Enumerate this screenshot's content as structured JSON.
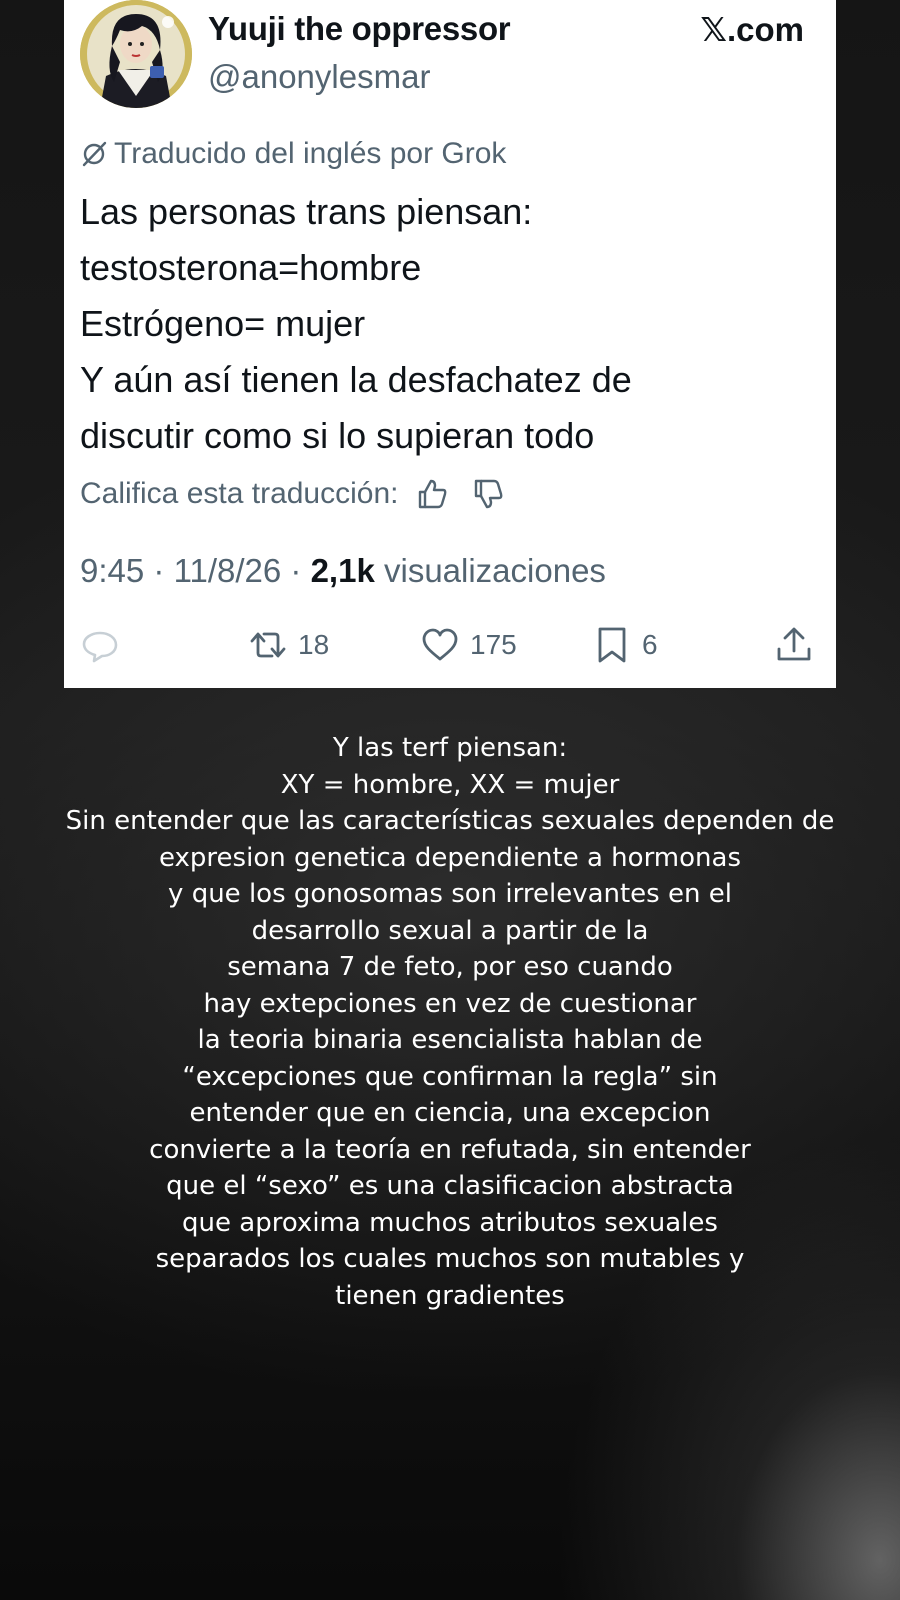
{
  "tweet": {
    "author": {
      "display_name": "Yuuji the oppressor",
      "handle": "@anonylesmar",
      "avatar_icon": "comic-portrait-avatar"
    },
    "brand": "𝕏.com",
    "translation_notice": "Traducido del inglés por Grok",
    "text_lines": [
      "Las personas trans piensan:",
      "testosterona=hombre",
      "Estrógeno= mujer",
      "Y aún así tienen la desfachatez de",
      "discutir como si lo supieran todo"
    ],
    "rate_translation_label": "Califica esta traducción:",
    "time": "9:45",
    "date": "11/8/26",
    "views_count": "2,1k",
    "views_label": "visualizaciones",
    "separator": "·",
    "actions": {
      "reply_count": "",
      "retweet_count": "18",
      "like_count": "175",
      "bookmark_count": "6"
    }
  },
  "caption": {
    "lines": [
      "Y las terf piensan:",
      "XY = hombre, XX = mujer",
      "Sin entender que las características sexuales dependen de",
      "expresion genetica dependiente a hormonas",
      "y que los gonosomas son irrelevantes en el",
      "desarrollo sexual a partir de la",
      "semana 7 de feto, por eso cuando",
      "hay extepciones en vez de cuestionar",
      "la teoria binaria esencialista hablan de",
      "“excepciones que confirman la regla” sin",
      "entender que en ciencia, una excepcion",
      "convierte a la teoría en refutada, sin entender",
      "que el “sexo” es una clasificacion abstracta",
      "que aproxima muchos atributos sexuales",
      "separados los cuales muchos son mutables y",
      "tienen gradientes"
    ]
  },
  "colors": {
    "card_bg": "#ffffff",
    "primary_text": "#0f1419",
    "secondary_text": "#536471",
    "caption_text": "#ffffff",
    "page_bg": "#151515"
  }
}
